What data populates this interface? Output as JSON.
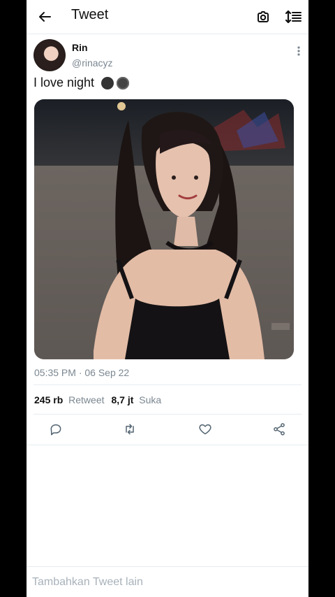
{
  "header": {
    "title": "Tweet"
  },
  "tweet": {
    "name": "Rin",
    "handle": "@rinacyz",
    "text": "I love night",
    "emojis": [
      "bomb",
      "moon-face"
    ],
    "timestamp": "05:35 PM · 06 Sep 22",
    "stats": {
      "retweets_value": "245 rb",
      "retweets_label": "Retweet",
      "likes_value": "8,7 jt",
      "likes_label": "Suka"
    }
  },
  "composer": {
    "placeholder": "Tambahkan Tweet lain"
  }
}
